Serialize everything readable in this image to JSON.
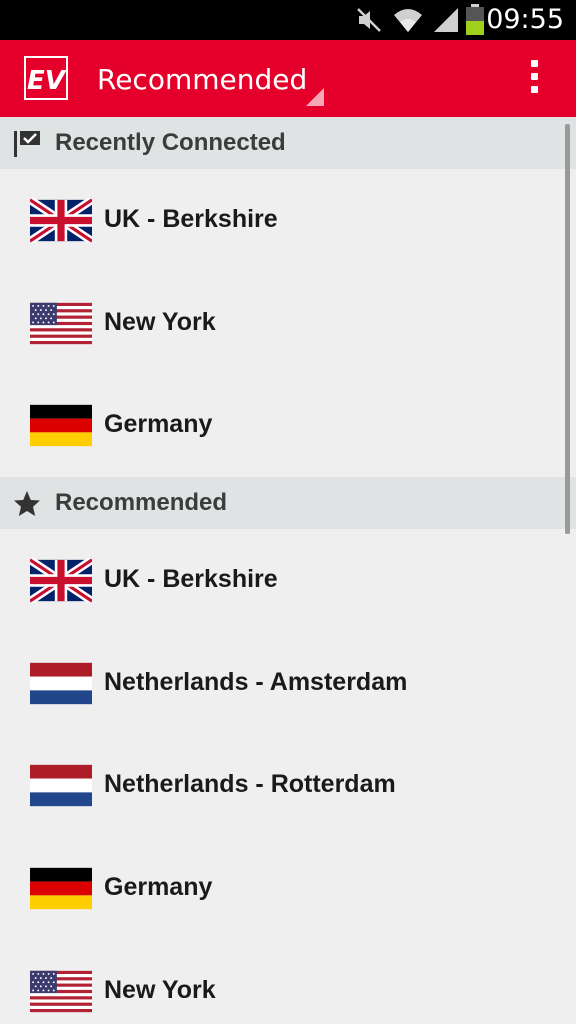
{
  "status_bar": {
    "time": "09:55",
    "icons": [
      "mute-icon",
      "wifi-icon",
      "signal-icon",
      "battery-icon"
    ]
  },
  "app_bar": {
    "title": "Recommended",
    "logo_text": "EV",
    "brand_color": "#e4002b"
  },
  "sections": [
    {
      "title": "Recently Connected",
      "icon": "recent-flag-icon",
      "items": [
        {
          "name": "UK - Berkshire",
          "flag": "uk"
        },
        {
          "name": "New York",
          "flag": "us"
        },
        {
          "name": "Germany",
          "flag": "de"
        }
      ]
    },
    {
      "title": "Recommended",
      "icon": "star-icon",
      "items": [
        {
          "name": "UK - Berkshire",
          "flag": "uk"
        },
        {
          "name": "Netherlands - Amsterdam",
          "flag": "nl"
        },
        {
          "name": "Netherlands - Rotterdam",
          "flag": "nl"
        },
        {
          "name": "Germany",
          "flag": "de"
        },
        {
          "name": "New York",
          "flag": "us"
        }
      ]
    }
  ]
}
